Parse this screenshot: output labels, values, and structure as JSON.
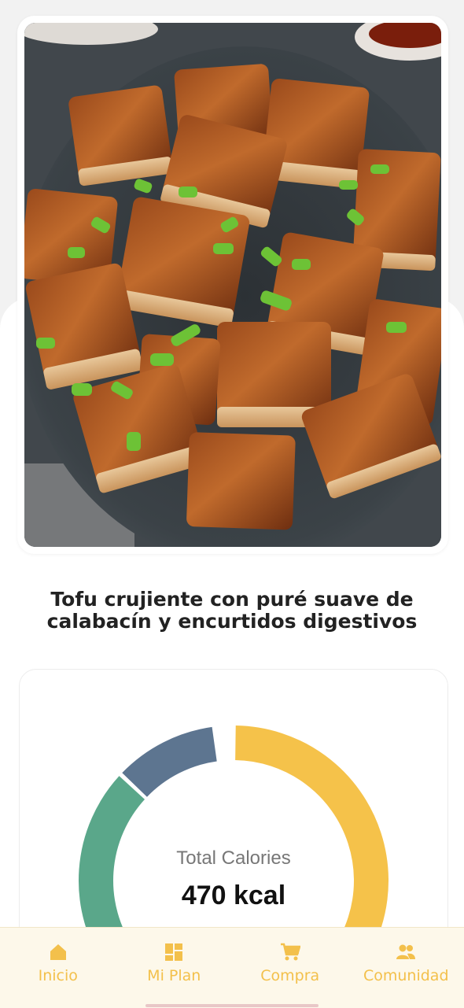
{
  "recipe": {
    "title": "Tofu crujiente con puré suave de calabacín y encurtidos digestivos",
    "image_alt": "glazed crispy tofu cubes with sesame and green onion on a dark plate"
  },
  "calories": {
    "label": "Total Calories",
    "value": "470 kcal",
    "segments": [
      {
        "name": "segment-yellow",
        "fraction": 0.4,
        "color": "#f5c24a"
      },
      {
        "name": "segment-red",
        "fraction": 0.04,
        "color": "#e05548"
      },
      {
        "name": "segment-green",
        "fraction": 0.43,
        "color": "#5aa78a"
      },
      {
        "name": "segment-slate",
        "fraction": 0.11,
        "color": "#5d7590"
      }
    ]
  },
  "nav": {
    "items": [
      {
        "label": "Inicio",
        "icon": "home-icon"
      },
      {
        "label": "Mi Plan",
        "icon": "grid-icon"
      },
      {
        "label": "Compra",
        "icon": "cart-icon"
      },
      {
        "label": "Comunidad",
        "icon": "people-icon"
      }
    ],
    "accent": "#f3c04b"
  }
}
